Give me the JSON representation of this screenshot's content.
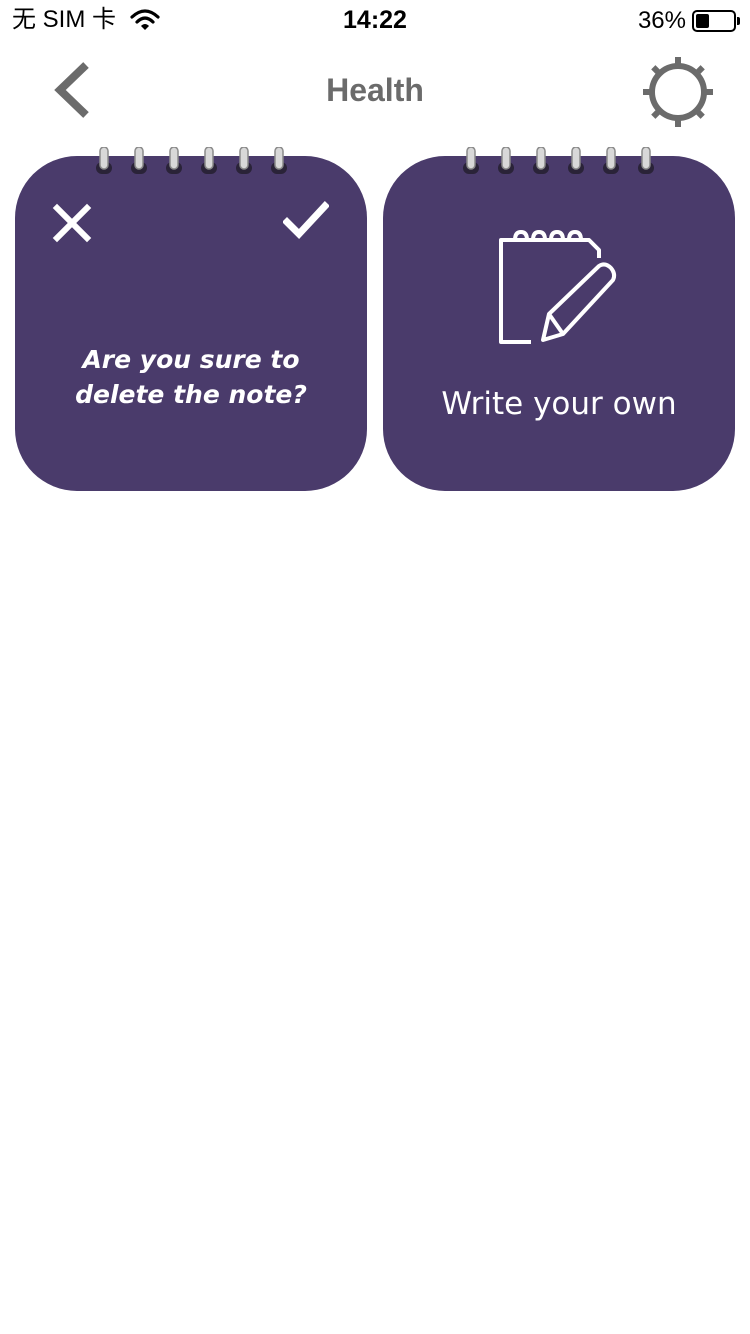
{
  "status_bar": {
    "carrier": "无 SIM 卡",
    "time": "14:22",
    "battery_percent": "36%",
    "battery_level": 0.36
  },
  "nav": {
    "title": "Health",
    "back_icon": "chevron-left-icon",
    "settings_icon": "gear-icon"
  },
  "cards": {
    "delete_card": {
      "prompt": "Are you sure to delete the note?",
      "cancel_icon": "close-icon",
      "confirm_icon": "checkmark-icon"
    },
    "write_card": {
      "label": "Write your own",
      "icon": "note-edit-icon"
    }
  },
  "colors": {
    "card_background": "#4a3b6b",
    "nav_icon": "#6b6b6b",
    "card_text": "#ffffff"
  }
}
